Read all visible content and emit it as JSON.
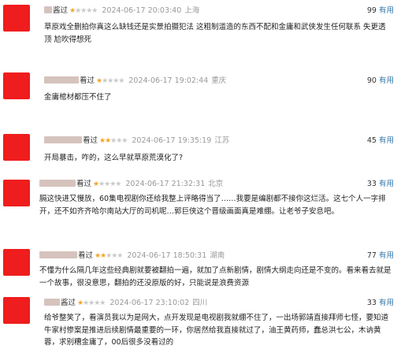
{
  "reviews": [
    {
      "user": "酱过",
      "stars": 1,
      "date": "2024-06-17 20:03:40",
      "location": "上海",
      "useful_count": "99",
      "useful_label": "有用",
      "text": "草原戏全删拍你真这么缺钱还是实景拍摄犯法 这粗制滥造的东西不配和金庸和武侠发生任何联系 失更透顶 尬吹得想死"
    },
    {
      "user": "看过",
      "stars": 1,
      "date": "2024-06-17 19:02:44",
      "location": "重庆",
      "useful_count": "90",
      "useful_label": "有用",
      "text": "金庸棺材都压不住了"
    },
    {
      "user": "看过",
      "stars": 2,
      "date": "2024-06-17 19:35:19",
      "location": "江苏",
      "useful_count": "45",
      "useful_label": "有用",
      "text": "开局暴击，咋的，这么早就草原荒漠化了?"
    },
    {
      "user": "看过",
      "stars": 1,
      "date": "2024-06-17 21:32:31",
      "location": "北京",
      "useful_count": "33",
      "useful_label": "有用",
      "text": "膈这快进又慢放，60集电视剧你还给我整上评略得当了……我要是编剧都不接你这烂活。这七个人一字排开，还不如齐齐哈尔南站大厅的司机呢…郭巨侠这个晋级画面真是难绷。让老爷子安息吧。"
    },
    {
      "user": "看过",
      "stars": 2,
      "date": "2024-06-17 18:50:31",
      "location": "湖南",
      "useful_count": "77",
      "useful_label": "有用",
      "text": "不懂为什么隔几年这些经典剧就要被翻拍一遍，就加了点新剧情，剧情大纲走向还是不变的。看来看去就是一个故事，很没意思，翻拍的还没原版的好，只能说是浪费资源"
    },
    {
      "user": "酱过",
      "stars": 1,
      "date": "2024-06-17 23:10:02",
      "location": "四川",
      "useful_count": "33",
      "useful_label": "有用",
      "text": "给爷整笑了，看演员我以为是网大，点开发现是电视剧我就绷不住了，一出场郭靖直接拜师七怪，要知道牛家村惨案是推进后续剧情最重要的一环，你居然给我直接就过了，油王黄药师，蠢总洪七公，木讷黄蓉，求别糟金庸了，00后很多没看过的"
    }
  ]
}
